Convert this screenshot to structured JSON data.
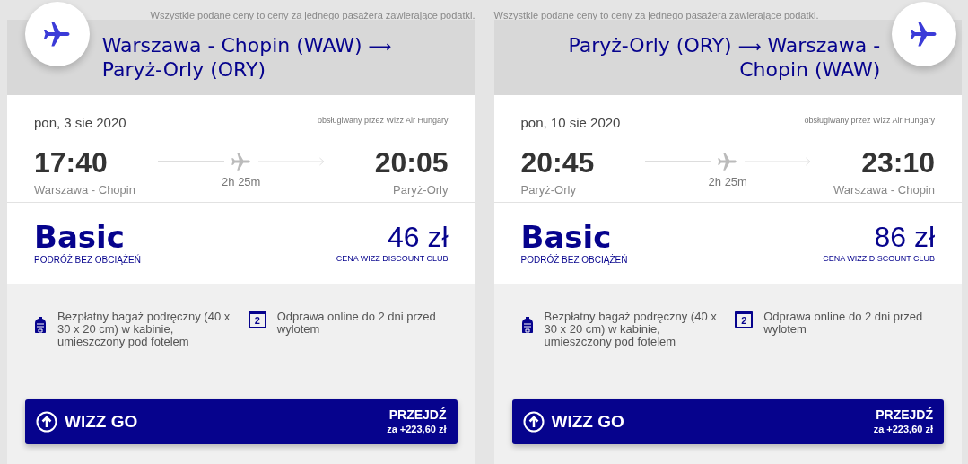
{
  "cards": [
    {
      "kind": "outbound",
      "notice": "Wszystkie podane ceny to ceny za jednego pasażera zawierające podatki.",
      "route": {
        "from": "Warszawa - Chopin (WAW)",
        "arrow": "⟶",
        "to": "Paryż-Orly (ORY)"
      },
      "flight": {
        "date": "pon, 3 sie 2020",
        "operator": "obsługiwany przez Wizz Air Hungary",
        "departure_time": "17:40",
        "departure_airport": "Warszawa - Chopin",
        "duration": "2h 25m",
        "arrival_time": "20:05",
        "arrival_airport": "Paryż-Orly"
      },
      "fare": {
        "name": "Basic",
        "subtitle": "PODRÓŻ BEZ OBCIĄŻEŃ",
        "price": "46 zł",
        "price_note": "CENA WIZZ DISCOUNT CLUB"
      },
      "features": [
        {
          "kind": "bag",
          "text": "Bezpłatny bagaż podręczny (40 x 30 x 20 cm) w kabinie, umieszczony pod fotelem"
        },
        {
          "kind": "calendar",
          "icon_text": "2",
          "text": "Odprawa online do 2 dni przed wylotem"
        }
      ],
      "upgrade": {
        "label": "WIZZ GO",
        "action": "PRZEJDŹ",
        "price": "za +223,60 zł"
      }
    },
    {
      "kind": "return",
      "notice": "Wszystkie podane ceny to ceny za jednego pasażera zawierające podatki.",
      "route": {
        "from": "Paryż-Orly (ORY)",
        "arrow": "⟶",
        "to": "Warszawa - Chopin (WAW)"
      },
      "flight": {
        "date": "pon, 10 sie 2020",
        "operator": "obsługiwany przez Wizz Air Hungary",
        "departure_time": "20:45",
        "departure_airport": "Paryż-Orly",
        "duration": "2h 25m",
        "arrival_time": "23:10",
        "arrival_airport": "Warszawa - Chopin"
      },
      "fare": {
        "name": "Basic",
        "subtitle": "PODRÓŻ BEZ OBCIĄŻEŃ",
        "price": "86 zł",
        "price_note": "CENA WIZZ DISCOUNT CLUB"
      },
      "features": [
        {
          "kind": "bag",
          "text": "Bezpłatny bagaż podręczny (40 x 30 x 20 cm) w kabinie, umieszczony pod fotelem"
        },
        {
          "kind": "calendar",
          "icon_text": "2",
          "text": "Odprawa online do 2 dni przed wylotem"
        }
      ],
      "upgrade": {
        "label": "WIZZ GO",
        "action": "PRZEJDŹ",
        "price": "za +223,60 zł"
      }
    }
  ]
}
